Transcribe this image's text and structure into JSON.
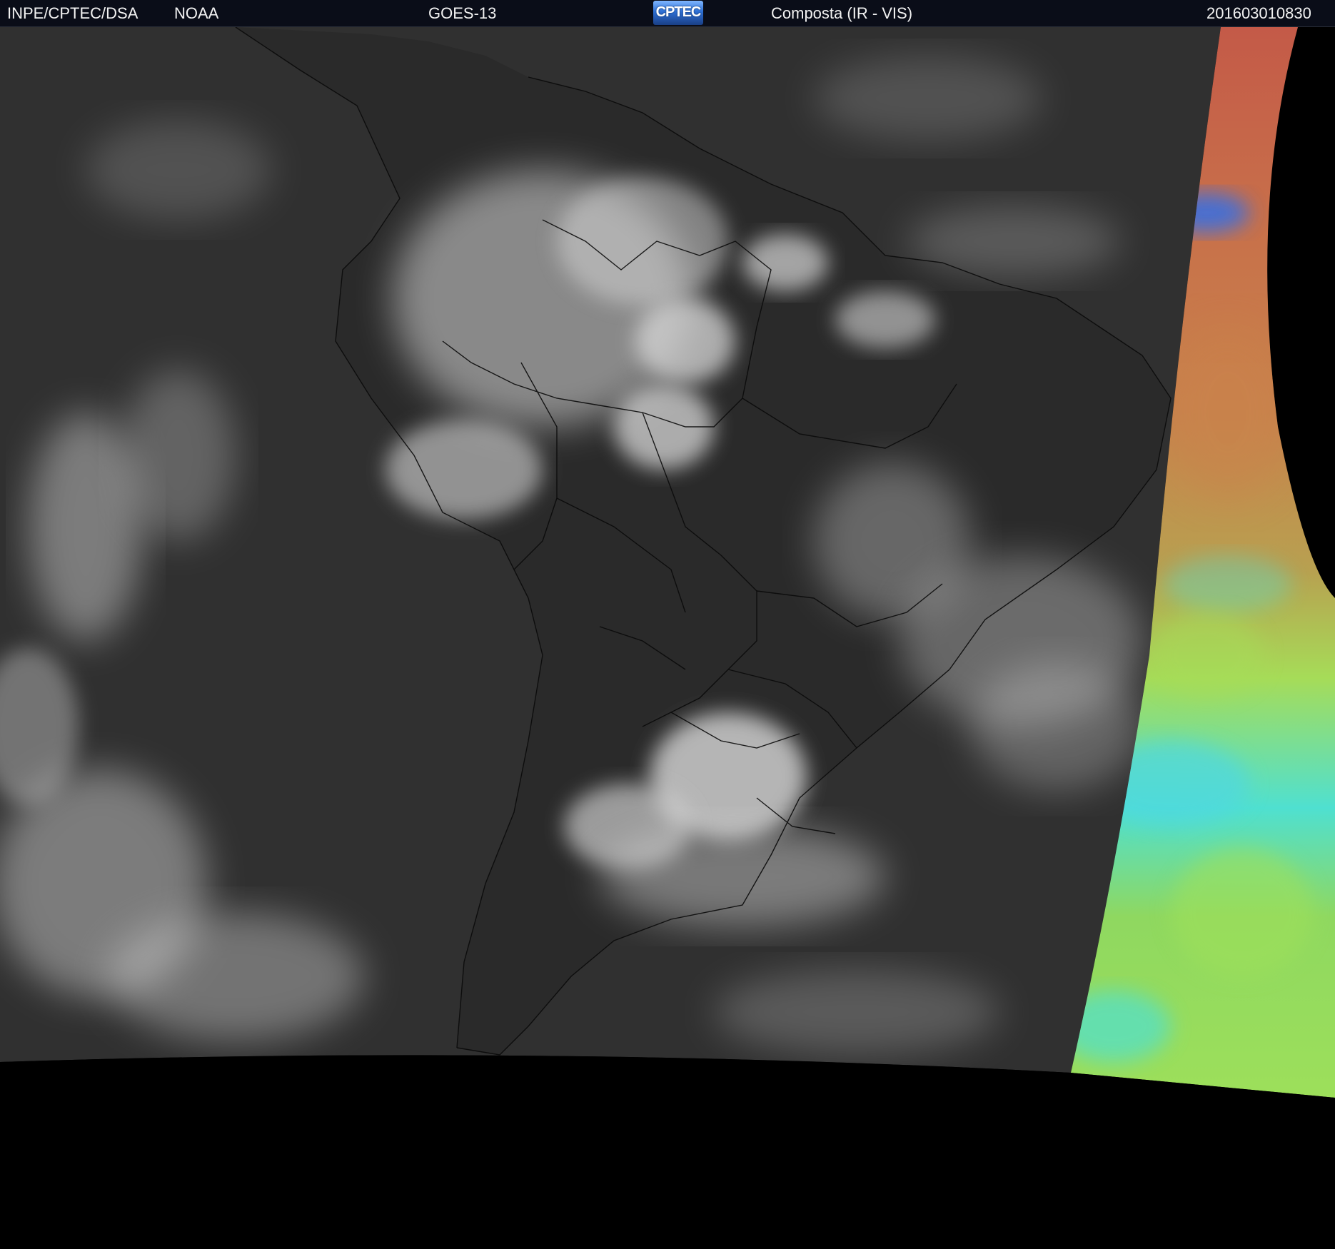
{
  "header": {
    "institution": "INPE/CPTEC/DSA",
    "agency": "NOAA",
    "satellite": "GOES-13",
    "logo_text": "CPTEC",
    "product": "Composta (IR - VIS)",
    "timestamp": "201603010830"
  },
  "colors": {
    "header_bg": "#0a0d18",
    "ocean_gray": "#303030",
    "land_gray": "#2a2a2a",
    "cloud_white": "#d8d8d8",
    "no_data": "#000000",
    "composite_orange": "#c96a4a",
    "composite_green": "#9ee05a",
    "composite_cyan": "#4fe0d8",
    "composite_blue": "#3a6fe0"
  }
}
